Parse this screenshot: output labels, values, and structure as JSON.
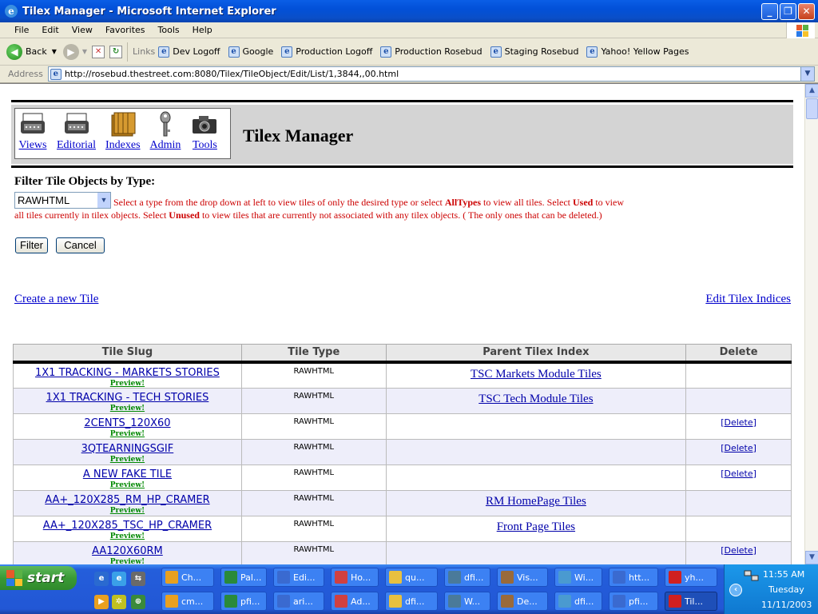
{
  "window": {
    "title": "Tilex Manager - Microsoft Internet Explorer"
  },
  "menu": [
    "File",
    "Edit",
    "View",
    "Favorites",
    "Tools",
    "Help"
  ],
  "toolbar": {
    "back_label": "Back",
    "links_label": "Links",
    "links": [
      "Dev Logoff",
      "Google",
      "Production Logoff",
      "Production Rosebud",
      "Staging Rosebud",
      "Yahoo! Yellow Pages"
    ]
  },
  "address": {
    "label": "Address",
    "url": "http://rosebud.thestreet.com:8080/Tilex/TileObject/Edit/List/1,3844,,00.html"
  },
  "header": {
    "title": "Tilex Manager",
    "tools": [
      "Views",
      "Editorial",
      "Indexes",
      "Admin",
      "Tools"
    ]
  },
  "filter": {
    "title": "Filter Tile Objects by Type:",
    "selected": "RAWHTML",
    "help_a": "Select a type from the drop down at left to view tiles of only the desired type or select ",
    "help_b": "AllTypes",
    "help_c": " to view all tiles. Select ",
    "help_d": "Used",
    "help_e": " to view all tiles currently in tilex objects. Select ",
    "help_f": "Unused",
    "help_g": " to view tiles that are currently not associated with any tilex objects. ( The only ones that can be deleted.)",
    "filter_button": "Filter",
    "cancel_button": "Cancel"
  },
  "links": {
    "create": "Create a new Tile",
    "edit_indices": "Edit Tilex Indices"
  },
  "table": {
    "headers": [
      "Tile Slug",
      "Tile Type",
      "Parent Tilex Index",
      "Delete"
    ],
    "preview_label": "Preview!",
    "rows": [
      {
        "slug": "1X1 TRACKING - MARKETS STORIES",
        "type": "RAWHTML",
        "parent": "TSC Markets Module Tiles",
        "delete": ""
      },
      {
        "slug": "1X1 TRACKING - TECH STORIES",
        "type": "RAWHTML",
        "parent": "TSC Tech Module Tiles",
        "delete": ""
      },
      {
        "slug": "2CENTS_120X60",
        "type": "RAWHTML",
        "parent": "",
        "delete": "[Delete]"
      },
      {
        "slug": "3QTEARNINGSGIF",
        "type": "RAWHTML",
        "parent": "",
        "delete": "[Delete]"
      },
      {
        "slug": "A NEW FAKE TILE",
        "type": "RAWHTML",
        "parent": "",
        "delete": "[Delete]"
      },
      {
        "slug": "AA+_120X285_RM_HP_CRAMER",
        "type": "RAWHTML",
        "parent": "RM HomePage Tiles",
        "delete": ""
      },
      {
        "slug": "AA+_120X285_TSC_HP_CRAMER",
        "type": "RAWHTML",
        "parent": "Front Page Tiles",
        "delete": ""
      },
      {
        "slug": "AA120X60RM",
        "type": "RAWHTML",
        "parent": "",
        "delete": "[Delete]"
      }
    ]
  },
  "taskbar": {
    "start_label": "start",
    "row1": [
      "Ch...",
      "Pal...",
      "Edi...",
      "Ho...",
      "qu...",
      "dfi...",
      "Vis...",
      "Wi...",
      "htt...",
      "yh..."
    ],
    "row2": [
      "cm...",
      "pfi...",
      "ari...",
      "Ad...",
      "dfi...",
      "W...",
      "De...",
      "dfi...",
      "pfi...",
      "Til..."
    ],
    "clock": "11:55 AM",
    "day": "Tuesday",
    "date": "11/11/2003"
  },
  "colors": {
    "titlebar": "#0a5ee6",
    "help_text": "#cc0000",
    "link": "#0000cc",
    "taskbar": "#245edb"
  }
}
